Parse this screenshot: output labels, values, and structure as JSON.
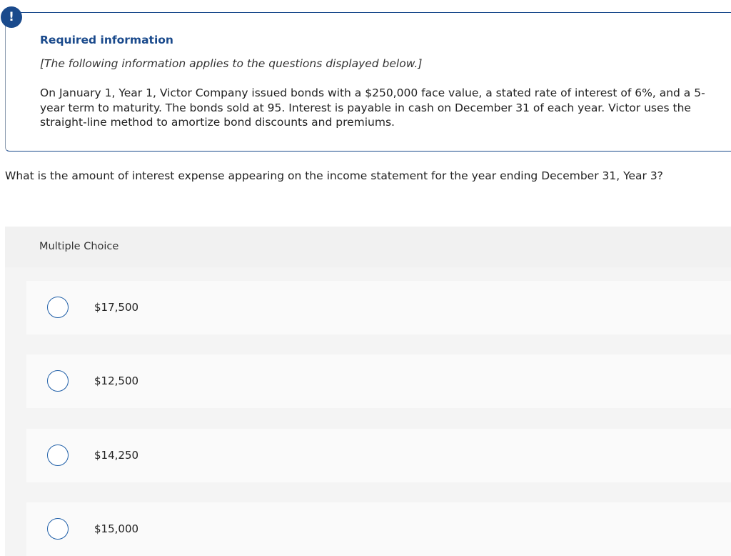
{
  "alert": {
    "glyph": "!"
  },
  "info": {
    "title": "Required information",
    "note": "[The following information applies to the questions displayed below.]",
    "body": "On January 1, Year 1, Victor Company issued bonds with a $250,000 face value, a stated rate of interest of 6%, and a 5-year term to maturity. The bonds sold at 95. Interest is payable in cash on December 31 of each year. Victor uses the straight-line method to amortize bond discounts and premiums."
  },
  "question": {
    "text": "What is the amount of interest expense appearing on the income statement for the year ending December 31, Year 3?"
  },
  "multiple_choice": {
    "header": "Multiple Choice",
    "options": [
      {
        "label": "$17,500"
      },
      {
        "label": "$12,500"
      },
      {
        "label": "$14,250"
      },
      {
        "label": "$15,000"
      }
    ]
  },
  "colors": {
    "accent": "#1a4a8c",
    "radio_border": "#1f5fa8",
    "panel_background": "#f4f4f4",
    "option_background": "#fafafa"
  }
}
